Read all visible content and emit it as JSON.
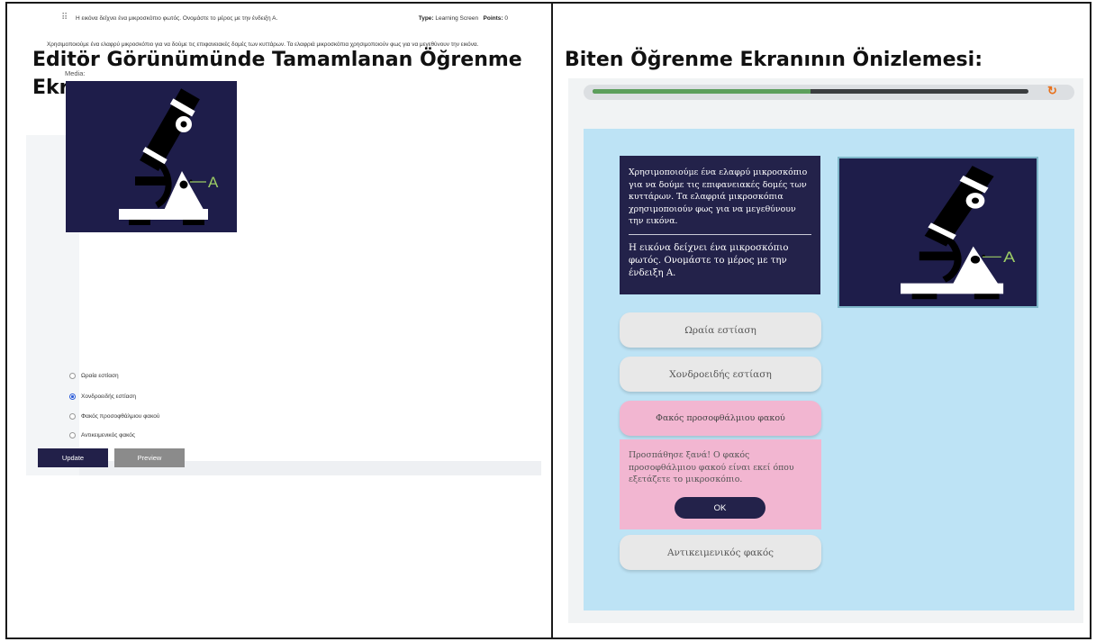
{
  "left_panel": {
    "heading": "Editör Görünümünde Tamamlanan Öğrenme Ekranı:",
    "editor": {
      "question_text": "Η εικόνα δείχνει ένα μικροσκόπιο φωτός. Ονομάστε το μέρος με την ένδειξη Α.",
      "type_label": "Type:",
      "type_value": "Learning Screen",
      "points_label": "Points:",
      "points_value": "0",
      "description": "Χρησιμοποιούμε ένα ελαφρύ μικροσκόπιο για να δούμε τις επιφανειακές δομές των κυττάρων. Τα ελαφριά μικροσκόπια χρησιμοποιούν φως για να μεγεθύνουν την εικόνα.",
      "media_label": "Media:",
      "image_label_letter": "A",
      "options": [
        {
          "label": "Ωραία εστίαση",
          "selected": false
        },
        {
          "label": "Χονδροειδής εστίαση",
          "selected": true
        },
        {
          "label": "Φακός προσοφθάλμιου φακού",
          "selected": false
        },
        {
          "label": "Αντικειμενικός φακός",
          "selected": false
        }
      ],
      "update_button": "Update",
      "preview_button": "Preview"
    }
  },
  "right_panel": {
    "heading": "Biten Öğrenme Ekranının Önizlemesi:",
    "progress_fraction": 0.5,
    "text_box": {
      "description": "Χρησιμοποιούμε ένα ελαφρύ μικροσκόπιο για να δούμε τις επιφανειακές δομές των κυττάρων. Τα ελαφριά μικροσκόπια χρησιμοποιούν φως για να μεγεθύνουν την εικόνα.",
      "question": "Η εικόνα δείχνει ένα μικροσκόπιο φωτός. Ονομάστε το μέρος με την ένδειξη Α."
    },
    "image_label_letter": "A",
    "options": [
      "Ωραία εστίαση",
      "Χονδροειδής εστίαση",
      "Φακός προσοφθάλμιου φακού",
      "Αντικειμενικός φακός"
    ],
    "feedback": "Προσπάθησε ξανά! Ο φακός προσοφθάλμιου φακού είναι εκεί όπου εξετάζετε το μικροσκόπιο.",
    "ok_button": "OK"
  },
  "colors": {
    "navy": "#23224a",
    "stage_blue": "#bde3f5",
    "selected_pink": "#f2b6d1",
    "progress_green": "#5c9f5c",
    "reload_orange": "#e8701a",
    "label_green": "#9ccc65"
  },
  "icons": {
    "reload": "reload-icon",
    "drag": "drag-handle-icon"
  }
}
